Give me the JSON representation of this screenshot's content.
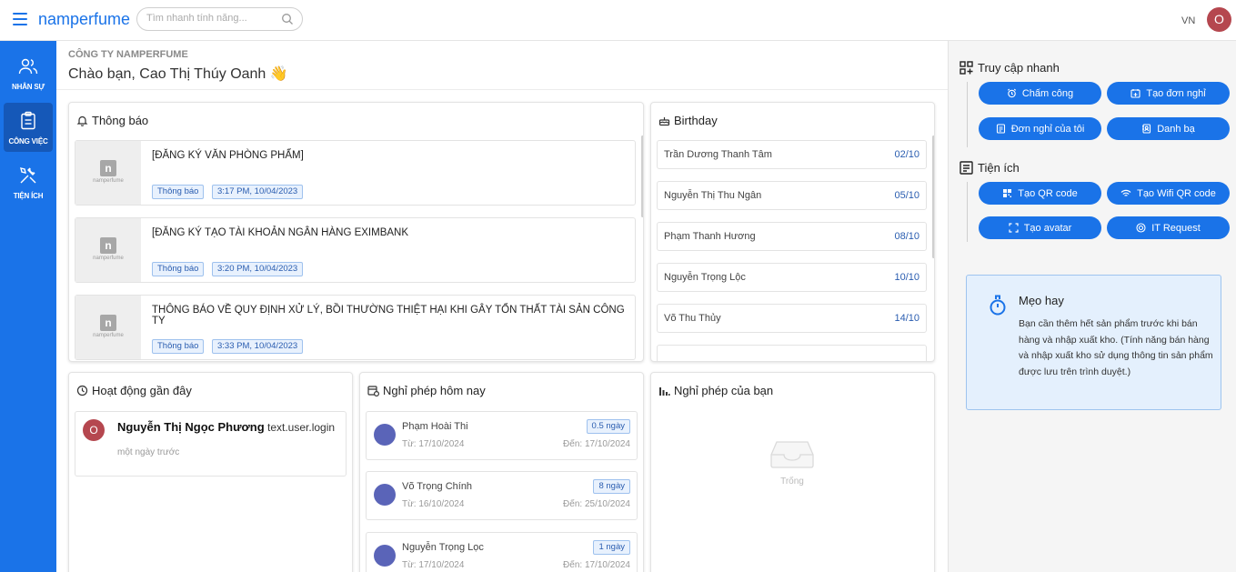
{
  "app": {
    "brand": "namperfume",
    "search_placeholder": "Tìm nhanh tính năng...",
    "lang": "VN",
    "user_initial": "O"
  },
  "sidebar": {
    "items": [
      {
        "label": "NHÂN SỰ",
        "icon": "users-icon"
      },
      {
        "label": "CÔNG VIỆC",
        "icon": "clipboard-icon"
      },
      {
        "label": "TIỆN ÍCH",
        "icon": "tools-icon"
      }
    ]
  },
  "header": {
    "company": "CÔNG TY NAMPERFUME",
    "greeting": "Chào bạn, Cao Thị Thúy Oanh 👋"
  },
  "notifications": {
    "title": "Thông báo",
    "items": [
      {
        "thumb_logo": "n",
        "thumb_sub": "namperfume",
        "title": "[ĐĂNG KÝ VĂN PHÒNG PHẨM]",
        "tag": "Thông báo",
        "time": "3:17 PM, 10/04/2023"
      },
      {
        "thumb_logo": "n",
        "thumb_sub": "namperfume",
        "title": "[ĐĂNG KÝ TẠO TÀI KHOẢN NGÂN HÀNG EXIMBANK",
        "tag": "Thông báo",
        "time": "3:20 PM, 10/04/2023"
      },
      {
        "thumb_logo": "n",
        "thumb_sub": "namperfume",
        "title": "THÔNG BÁO VỀ QUY ĐỊNH XỬ LÝ, BỒI THƯỜNG THIỆT HẠI KHI GÂY TỔN THẤT TÀI SẢN CÔNG TY",
        "tag": "Thông báo",
        "time": "3:33 PM, 10/04/2023"
      }
    ]
  },
  "birthday": {
    "title": "Birthday",
    "items": [
      {
        "name": "Trần Dương Thanh Tâm",
        "date": "02/10"
      },
      {
        "name": "Nguyễn Thị Thu Ngân",
        "date": "05/10"
      },
      {
        "name": "Phạm Thanh Hương",
        "date": "08/10"
      },
      {
        "name": "Nguyễn Trọng Lộc",
        "date": "10/10"
      },
      {
        "name": "Võ Thu Thủy",
        "date": "14/10"
      }
    ]
  },
  "activity": {
    "title": "Hoạt động gần đây",
    "items": [
      {
        "initial": "O",
        "name": "Nguyễn Thị Ngọc Phương",
        "action": "text.user.login",
        "time": "một ngày trước"
      }
    ]
  },
  "leave_today": {
    "title": "Nghỉ phép hôm nay",
    "items": [
      {
        "name": "Phạm Hoài Thi",
        "duration": "0.5 ngày",
        "from": "Từ: 17/10/2024",
        "to": "Đến: 17/10/2024"
      },
      {
        "name": "Võ Trọng Chính",
        "duration": "8 ngày",
        "from": "Từ: 16/10/2024",
        "to": "Đến: 25/10/2024"
      },
      {
        "name": "Nguyễn Trọng Lọc",
        "duration": "1 ngày",
        "from": "Từ: 17/10/2024",
        "to": "Đến: 17/10/2024"
      }
    ]
  },
  "my_leave": {
    "title": "Nghỉ phép của bạn",
    "empty_text": "Trống"
  },
  "quick_access": {
    "title": "Truy cập nhanh",
    "buttons": [
      {
        "label": "Chấm công",
        "icon": "alarm-clock-icon"
      },
      {
        "label": "Tạo đơn nghỉ",
        "icon": "calendar-plus-icon"
      },
      {
        "label": "Đơn nghỉ của tôi",
        "icon": "document-icon"
      },
      {
        "label": "Danh bạ",
        "icon": "contact-book-icon"
      }
    ]
  },
  "utilities": {
    "title": "Tiện ích",
    "buttons": [
      {
        "label": "Tạo QR code",
        "icon": "qr-code-icon"
      },
      {
        "label": "Tạo Wifi QR code",
        "icon": "wifi-icon"
      },
      {
        "label": "Tạo avatar",
        "icon": "crop-icon"
      },
      {
        "label": "IT Request",
        "icon": "target-icon"
      }
    ]
  },
  "tip": {
    "title": "Mẹo hay",
    "body": "Bạn cần thêm hết sản phẩm trước khi bán hàng và nhập xuất kho. (Tính năng bán hàng và nhập xuất kho sử dụng thông tin sản phẩm được lưu trên trình duyệt.)"
  },
  "colors": {
    "primary": "#1a73e8",
    "avatar": "#b5474f",
    "leave_avatar": "#5a64b8",
    "tip_bg": "#e4f0fd"
  }
}
